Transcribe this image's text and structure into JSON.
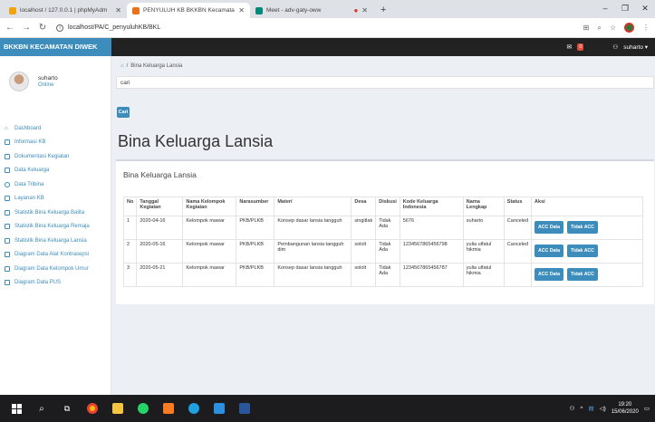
{
  "browser": {
    "tabs": [
      {
        "title": "localhost / 127.0.0.1 | phpMyAdm",
        "favicon_color": "#f0a30a",
        "active": false
      },
      {
        "title": "PENYULUH KB BKKBN Kecamata",
        "favicon_color": "#e8711c",
        "active": true
      },
      {
        "title": "Meet - adv-gaty-oww",
        "favicon_color": "#00897b",
        "active": false
      }
    ],
    "new_tab": "+",
    "url": "localhost/PA/C_penyuluhKB/BKL",
    "win_min": "–",
    "win_max": "❐",
    "win_close": "✕"
  },
  "app": {
    "brand": "BKKBN KECAMATAN DIWEK",
    "mail_badge": "0",
    "user_menu": "suharto ▾",
    "colors": {
      "brand": "#3c8dbc",
      "header": "#222222",
      "content_bg": "#ecf0f5"
    }
  },
  "sidebar": {
    "user_name": "suharto",
    "user_status": "Online",
    "items": [
      {
        "label": "Dashboard",
        "icon": "home-icon"
      },
      {
        "label": "Informasi KB",
        "icon": "list-icon"
      },
      {
        "label": "Dokumentasi Kegiatan",
        "icon": "list-icon"
      },
      {
        "label": "Data Keluarga",
        "icon": "list-icon"
      },
      {
        "label": "Data Tribina",
        "icon": "circle-icon"
      },
      {
        "label": "Layanan KB",
        "icon": "list-icon"
      },
      {
        "label": "Statistik Bina Keluarga Balita",
        "icon": "list-icon"
      },
      {
        "label": "Statistik Bina Keluarga Remaja",
        "icon": "list-icon"
      },
      {
        "label": "Statistik Bina Keluarga Lansia",
        "icon": "list-icon"
      },
      {
        "label": "Diagram Data Alat Kontrasepsi",
        "icon": "list-icon"
      },
      {
        "label": "Diagram Data Kelompok Umur",
        "icon": "list-icon"
      },
      {
        "label": "Diagram Data PUS",
        "icon": "list-icon"
      }
    ]
  },
  "main": {
    "breadcrumb": "Bina Keluarga Lansia",
    "search_value": "cari",
    "search_button": "Cari",
    "page_title": "Bina Keluarga Lansia",
    "box_title": "Bina Keluarga Lansia",
    "table": {
      "headers": [
        "No",
        "Tanggal Kegiatan",
        "Nama Kelompok Kegiatan",
        "Narasumber",
        "Materi",
        "Desa",
        "Diskusi",
        "Kode Keluarga Indonesia",
        "Nama Lengkap",
        "Status",
        "Aksi"
      ],
      "rows": [
        [
          "1",
          "2020-04-16",
          "Kelompok mawar",
          "PKB/PLKB",
          "Konsep dasar lansia tangguh",
          "singitlak",
          "Tidak Ada",
          "5676",
          "suharto",
          "Canceled"
        ],
        [
          "2",
          "2020-05-16",
          "Kelompok mawar",
          "PKB/PLKB",
          "Pembangunan lansia tangguh dim",
          "sololt",
          "Tidak Ada",
          "1234567865456798",
          "yulia ulfatul hikmia",
          "Canceled"
        ],
        [
          "3",
          "2020-05-21",
          "Kelompok mawar",
          "PKB/PLKB",
          "Konsep dasar lansia tangguh",
          "sololt",
          "Tidak Ada",
          "1234567865456787",
          "yulia ulfatul hikmia",
          ""
        ]
      ],
      "action_acc": "ACC Data",
      "action_reject": "Tidak ACC"
    }
  },
  "taskbar": {
    "time": "19:20",
    "date": "15/06/2020"
  }
}
